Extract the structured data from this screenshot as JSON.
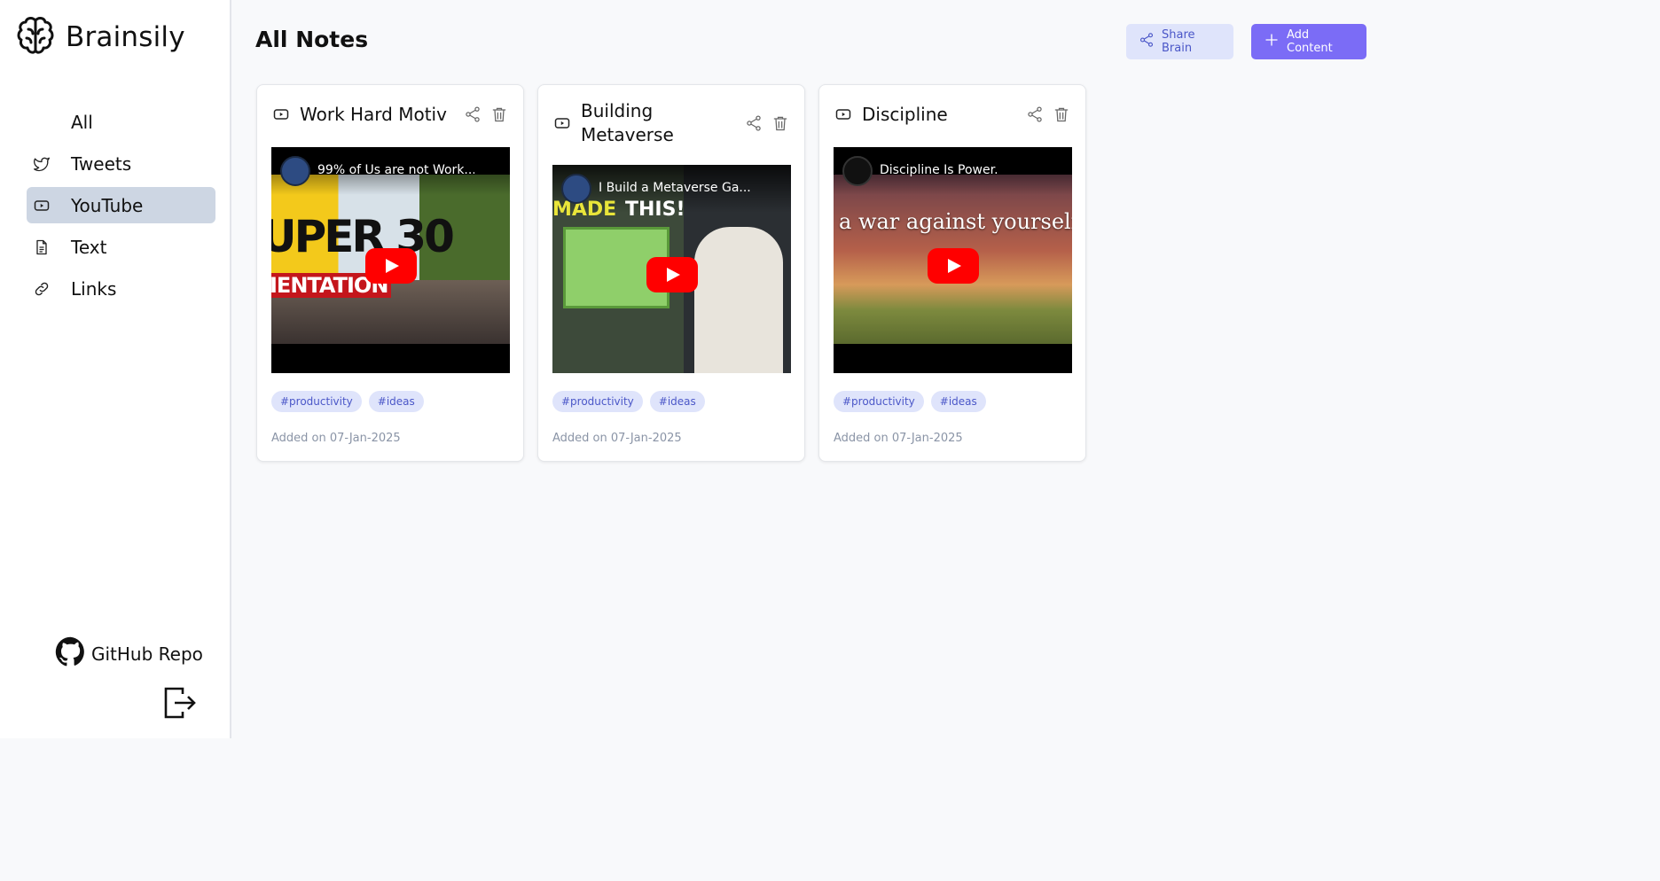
{
  "brand": {
    "name": "Brainsily",
    "icon": "brain-icon"
  },
  "sidebar": {
    "items": [
      {
        "label": "All",
        "icon": "",
        "active": false
      },
      {
        "label": "Tweets",
        "icon": "twitter-icon",
        "active": false
      },
      {
        "label": "YouTube",
        "icon": "youtube-icon",
        "active": true
      },
      {
        "label": "Text",
        "icon": "document-icon",
        "active": false
      },
      {
        "label": "Links",
        "icon": "link-icon",
        "active": false
      }
    ],
    "github_label": "GitHub Repo"
  },
  "header": {
    "title": "All Notes",
    "share_label": "Share Brain",
    "add_label": "Add Content"
  },
  "colors": {
    "active_nav": "#cdd6e3",
    "share_bg": "#dfe4fb",
    "accent": "#7b6cf6",
    "tag_text": "#4b57c8",
    "muted": "#8a94a6"
  },
  "cards": [
    {
      "title": "Work Hard Motiv",
      "type_icon": "youtube-icon",
      "video_title": "99% of Us are not Work...",
      "overlay_text": "UPER 30",
      "overlay_text_2": "IENTATION",
      "tags": [
        "#productivity",
        "#ideas"
      ],
      "added": "Added on 07-Jan-2025"
    },
    {
      "title": "Building Metaverse",
      "type_icon": "youtube-icon",
      "video_title": "I Build a Metaverse Ga...",
      "overlay_text": "MADE",
      "overlay_text_2": "THIS!",
      "tags": [
        "#productivity",
        "#ideas"
      ],
      "added": "Added on 07-Jan-2025"
    },
    {
      "title": "Discipline",
      "type_icon": "youtube-icon",
      "video_title": "Discipline Is Power.",
      "overlay_text": "a war against yourself.",
      "tags": [
        "#productivity",
        "#ideas"
      ],
      "added": "Added on 07-Jan-2025"
    }
  ]
}
